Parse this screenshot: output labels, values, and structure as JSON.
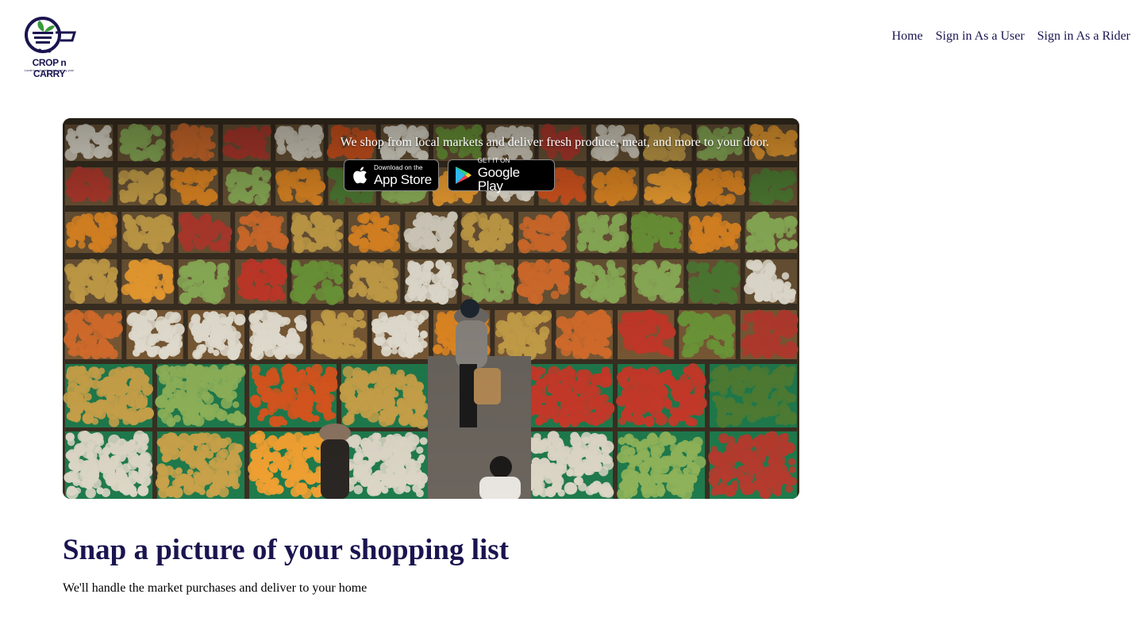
{
  "brand": {
    "name": "CROP n CARRY",
    "tagline": "Local bounty delivered, just by you!"
  },
  "nav": {
    "items": [
      {
        "label": "Home"
      },
      {
        "label": "Sign in As a User"
      },
      {
        "label": "Sign in As a Rider"
      }
    ]
  },
  "hero": {
    "tagline": "We shop from local markets and deliver fresh produce, meat, and more to your door.",
    "app_store": {
      "small": "Download on the",
      "big": "App Store"
    },
    "google_play": {
      "small": "GET IT ON",
      "big": "Google Play"
    }
  },
  "main": {
    "headline": "Snap a picture of your shopping list",
    "subline": "We'll handle the market purchases and deliver to your home"
  },
  "colors": {
    "brand_navy": "#1a1450",
    "leaf_green": "#3a9a3a"
  }
}
